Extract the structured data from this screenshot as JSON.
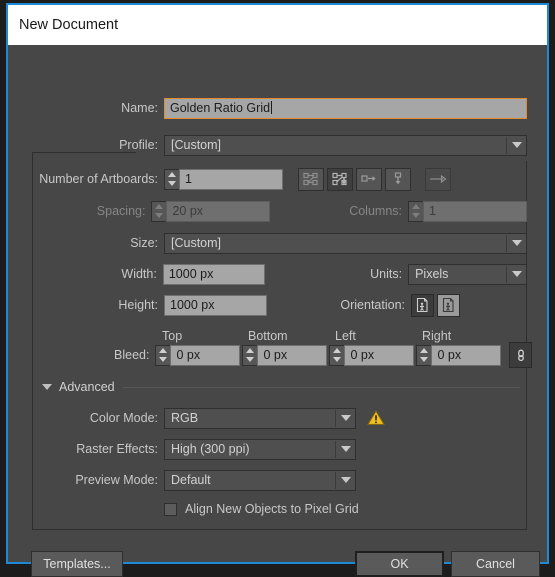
{
  "dialog": {
    "title": "New Document"
  },
  "fields": {
    "name_label": "Name:",
    "name_value": "Golden Ratio Grid",
    "profile_label": "Profile:",
    "profile_value": "[Custom]",
    "artboards_label": "Number of Artboards:",
    "artboards_value": "1",
    "spacing_label": "Spacing:",
    "spacing_value": "20 px",
    "columns_label": "Columns:",
    "columns_value": "1",
    "size_label": "Size:",
    "size_value": "[Custom]",
    "width_label": "Width:",
    "width_value": "1000 px",
    "height_label": "Height:",
    "height_value": "1000 px",
    "units_label": "Units:",
    "units_value": "Pixels",
    "orientation_label": "Orientation:",
    "bleed_label": "Bleed:",
    "bleed_top_header": "Top",
    "bleed_bottom_header": "Bottom",
    "bleed_left_header": "Left",
    "bleed_right_header": "Right",
    "bleed_top_value": "0 px",
    "bleed_bottom_value": "0 px",
    "bleed_left_value": "0 px",
    "bleed_right_value": "0 px"
  },
  "advanced": {
    "section_label": "Advanced",
    "color_mode_label": "Color Mode:",
    "color_mode_value": "RGB",
    "raster_label": "Raster Effects:",
    "raster_value": "High (300 ppi)",
    "preview_label": "Preview Mode:",
    "preview_value": "Default",
    "align_checkbox_label": "Align New Objects to Pixel Grid"
  },
  "footer": {
    "templates_label": "Templates...",
    "ok_label": "OK",
    "cancel_label": "Cancel"
  },
  "colors": {
    "focus_border": "#e08c2e",
    "dialog_border": "#1e8ad6",
    "warning": "#f0c020",
    "panel_bg": "#474747",
    "input_bg": "#a6a6a6"
  }
}
